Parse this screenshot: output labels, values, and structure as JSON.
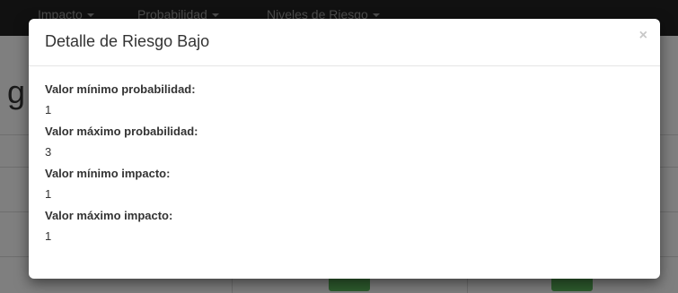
{
  "navbar": {
    "items": [
      {
        "label": "Impacto"
      },
      {
        "label": "Probabilidad"
      },
      {
        "label": "Niveles de Riesgo"
      }
    ]
  },
  "background": {
    "heading_fragment": "g"
  },
  "modal": {
    "title": "Detalle de Riesgo Bajo",
    "close_symbol": "×",
    "fields": [
      {
        "label": "Valor mínimo probabilidad:",
        "value": "1"
      },
      {
        "label": "Valor máximo probabilidad:",
        "value": "3"
      },
      {
        "label": "Valor mínimo impacto:",
        "value": "1"
      },
      {
        "label": "Valor máximo impacto:",
        "value": "1"
      }
    ]
  },
  "colors": {
    "navbar_bg": "#222222",
    "backdrop": "rgba(0,0,0,0.5)",
    "success_green": "#5cb85c",
    "modal_bg": "#ffffff"
  }
}
